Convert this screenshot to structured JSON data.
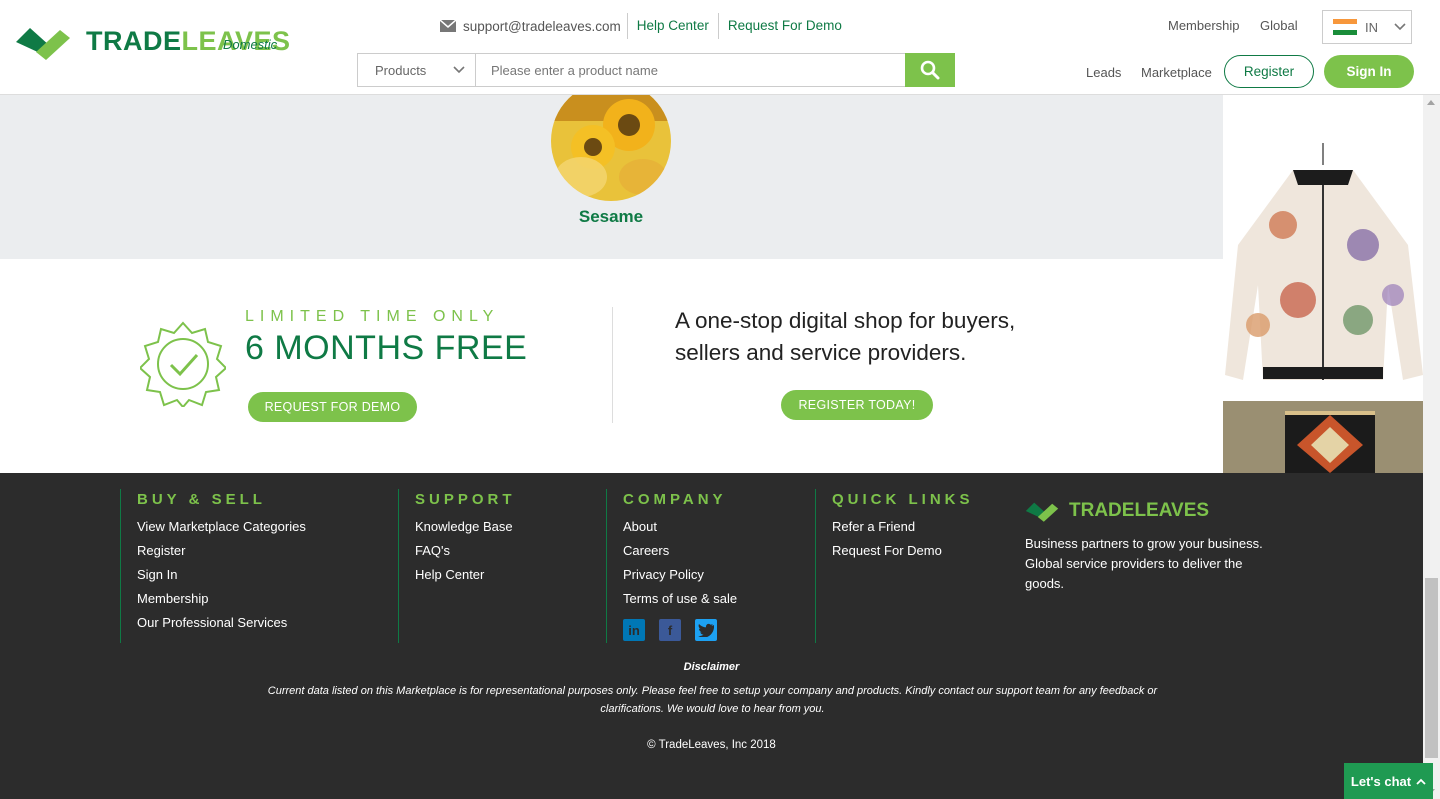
{
  "brand": {
    "name_part1": "TRADE",
    "name_part2": "LEAVES",
    "sub": "Domestic"
  },
  "toplinks": {
    "email": "support@tradeleaves.com",
    "help": "Help Center",
    "demo": "Request For Demo"
  },
  "search": {
    "category": "Products",
    "placeholder": "Please enter a product name"
  },
  "nav": {
    "membership": "Membership",
    "global": "Global",
    "leads": "Leads",
    "marketplace": "Marketplace",
    "country": "IN",
    "register": "Register",
    "signin": "Sign In"
  },
  "category": {
    "label": "Sesame"
  },
  "promo": {
    "limited": "LIMITED TIME ONLY",
    "months": "6 MONTHS FREE",
    "demo_button": "REQUEST FOR DEMO",
    "tagline_line1": "A one-stop digital shop for buyers,",
    "tagline_line2": "sellers and service providers.",
    "register_button": "REGISTER TODAY!"
  },
  "footer": {
    "columns": [
      {
        "title": "BUY & SELL",
        "links": [
          "View Marketplace Categories",
          "Register",
          "Sign In",
          "Membership",
          "Our Professional Services"
        ]
      },
      {
        "title": "SUPPORT",
        "links": [
          "Knowledge Base",
          "FAQ's",
          "Help Center"
        ]
      },
      {
        "title": "COMPANY",
        "links": [
          "About",
          "Careers",
          "Privacy Policy",
          "Terms of use & sale"
        ]
      },
      {
        "title": "QUICK LINKS",
        "links": [
          "Refer a Friend",
          "Request For Demo"
        ]
      }
    ],
    "brand_name": "TRADELEAVES",
    "brand_text": "Business partners to grow your business. Global service providers to deliver the goods.",
    "disclaimer_title": "Disclaimer",
    "disclaimer": "Current data listed on this Marketplace is for representational purposes only. Please feel free to setup your company and products. Kindly contact our support team for any feedback or clarifications. We would love to hear from you.",
    "copyright": "© TradeLeaves, Inc 2018",
    "social": [
      "linkedin-icon",
      "facebook-icon",
      "twitter-icon"
    ]
  },
  "chat": {
    "label": "Let's chat"
  },
  "colors": {
    "brand_dark": "#0f7a45",
    "brand_light": "#7dc24b",
    "footer_bg": "#2c2c2c",
    "band_bg": "#ebedef"
  }
}
